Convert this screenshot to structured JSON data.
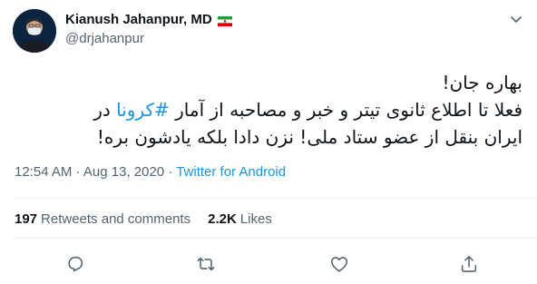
{
  "author": {
    "display_name": "Kianush Jahanpur, MD",
    "handle": "@drjahanpur",
    "flag": "iran-flag-icon",
    "avatar": "profile-photo-masked-man"
  },
  "tweet": {
    "line1": "بهاره جان!",
    "line2_before": "فعلا تا اطلاع ثانوی تیتر و خبر و مصاحبه از آمار ",
    "hashtag": "#کرونا",
    "line2_after": " در",
    "line3": "ایران بنقل از عضو ستاد ملی! نزن دادا بلکه یادشون بره!"
  },
  "meta": {
    "time": "12:54 AM",
    "separator": " · ",
    "date": "Aug 13, 2020",
    "source": "Twitter for Android"
  },
  "stats": {
    "retweets_count": "197",
    "retweets_label": "Retweets and comments",
    "likes_count": "2.2K",
    "likes_label": "Likes"
  },
  "colors": {
    "link": "#1b95e0",
    "text": "#0f1419",
    "secondary": "#536471",
    "divider": "#e6ecf0"
  },
  "icons": {
    "more": "chevron-down-icon",
    "reply": "reply-icon",
    "retweet": "retweet-icon",
    "like": "heart-icon",
    "share": "share-icon"
  }
}
